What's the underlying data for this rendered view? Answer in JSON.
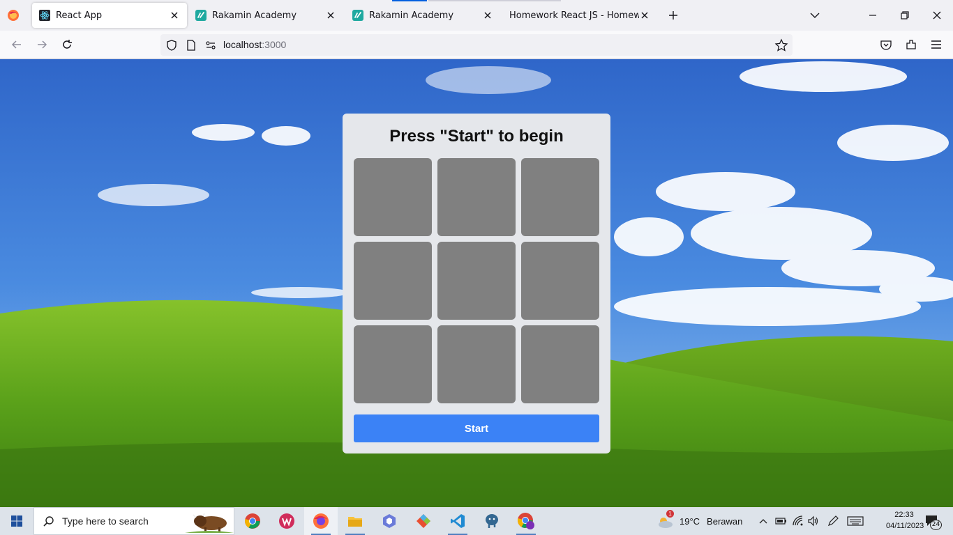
{
  "browser": {
    "tabs": [
      {
        "title": "React App",
        "active": true,
        "favicon": "react-icon"
      },
      {
        "title": "Rakamin Academy",
        "active": false,
        "favicon": "rakamin-icon"
      },
      {
        "title": "Rakamin Academy",
        "active": false,
        "favicon": "rakamin-icon"
      },
      {
        "title": "Homework React JS - Homework React JS",
        "active": false,
        "favicon": "none"
      }
    ],
    "url_host": "localhost",
    "url_port": ":3000"
  },
  "app": {
    "status": "Press \"Start\" to begin",
    "grid_cells": 9,
    "start_label": "Start"
  },
  "taskbar": {
    "search_placeholder": "Type here to search",
    "apps": [
      "chrome-icon",
      "wps-icon",
      "firefox-icon",
      "file-explorer-icon",
      "app-icon",
      "git-icon",
      "vscode-icon",
      "postgres-icon",
      "chrome-profile-icon"
    ],
    "weather_temp": "19°C",
    "weather_desc": "Berawan",
    "weather_alert": "1",
    "time": "22:33",
    "date": "04/11/2023",
    "notifications": "24"
  },
  "colors": {
    "accent_blue": "#3b82f6",
    "cell_gray": "#808080",
    "card_bg": "#e5e7eb"
  }
}
